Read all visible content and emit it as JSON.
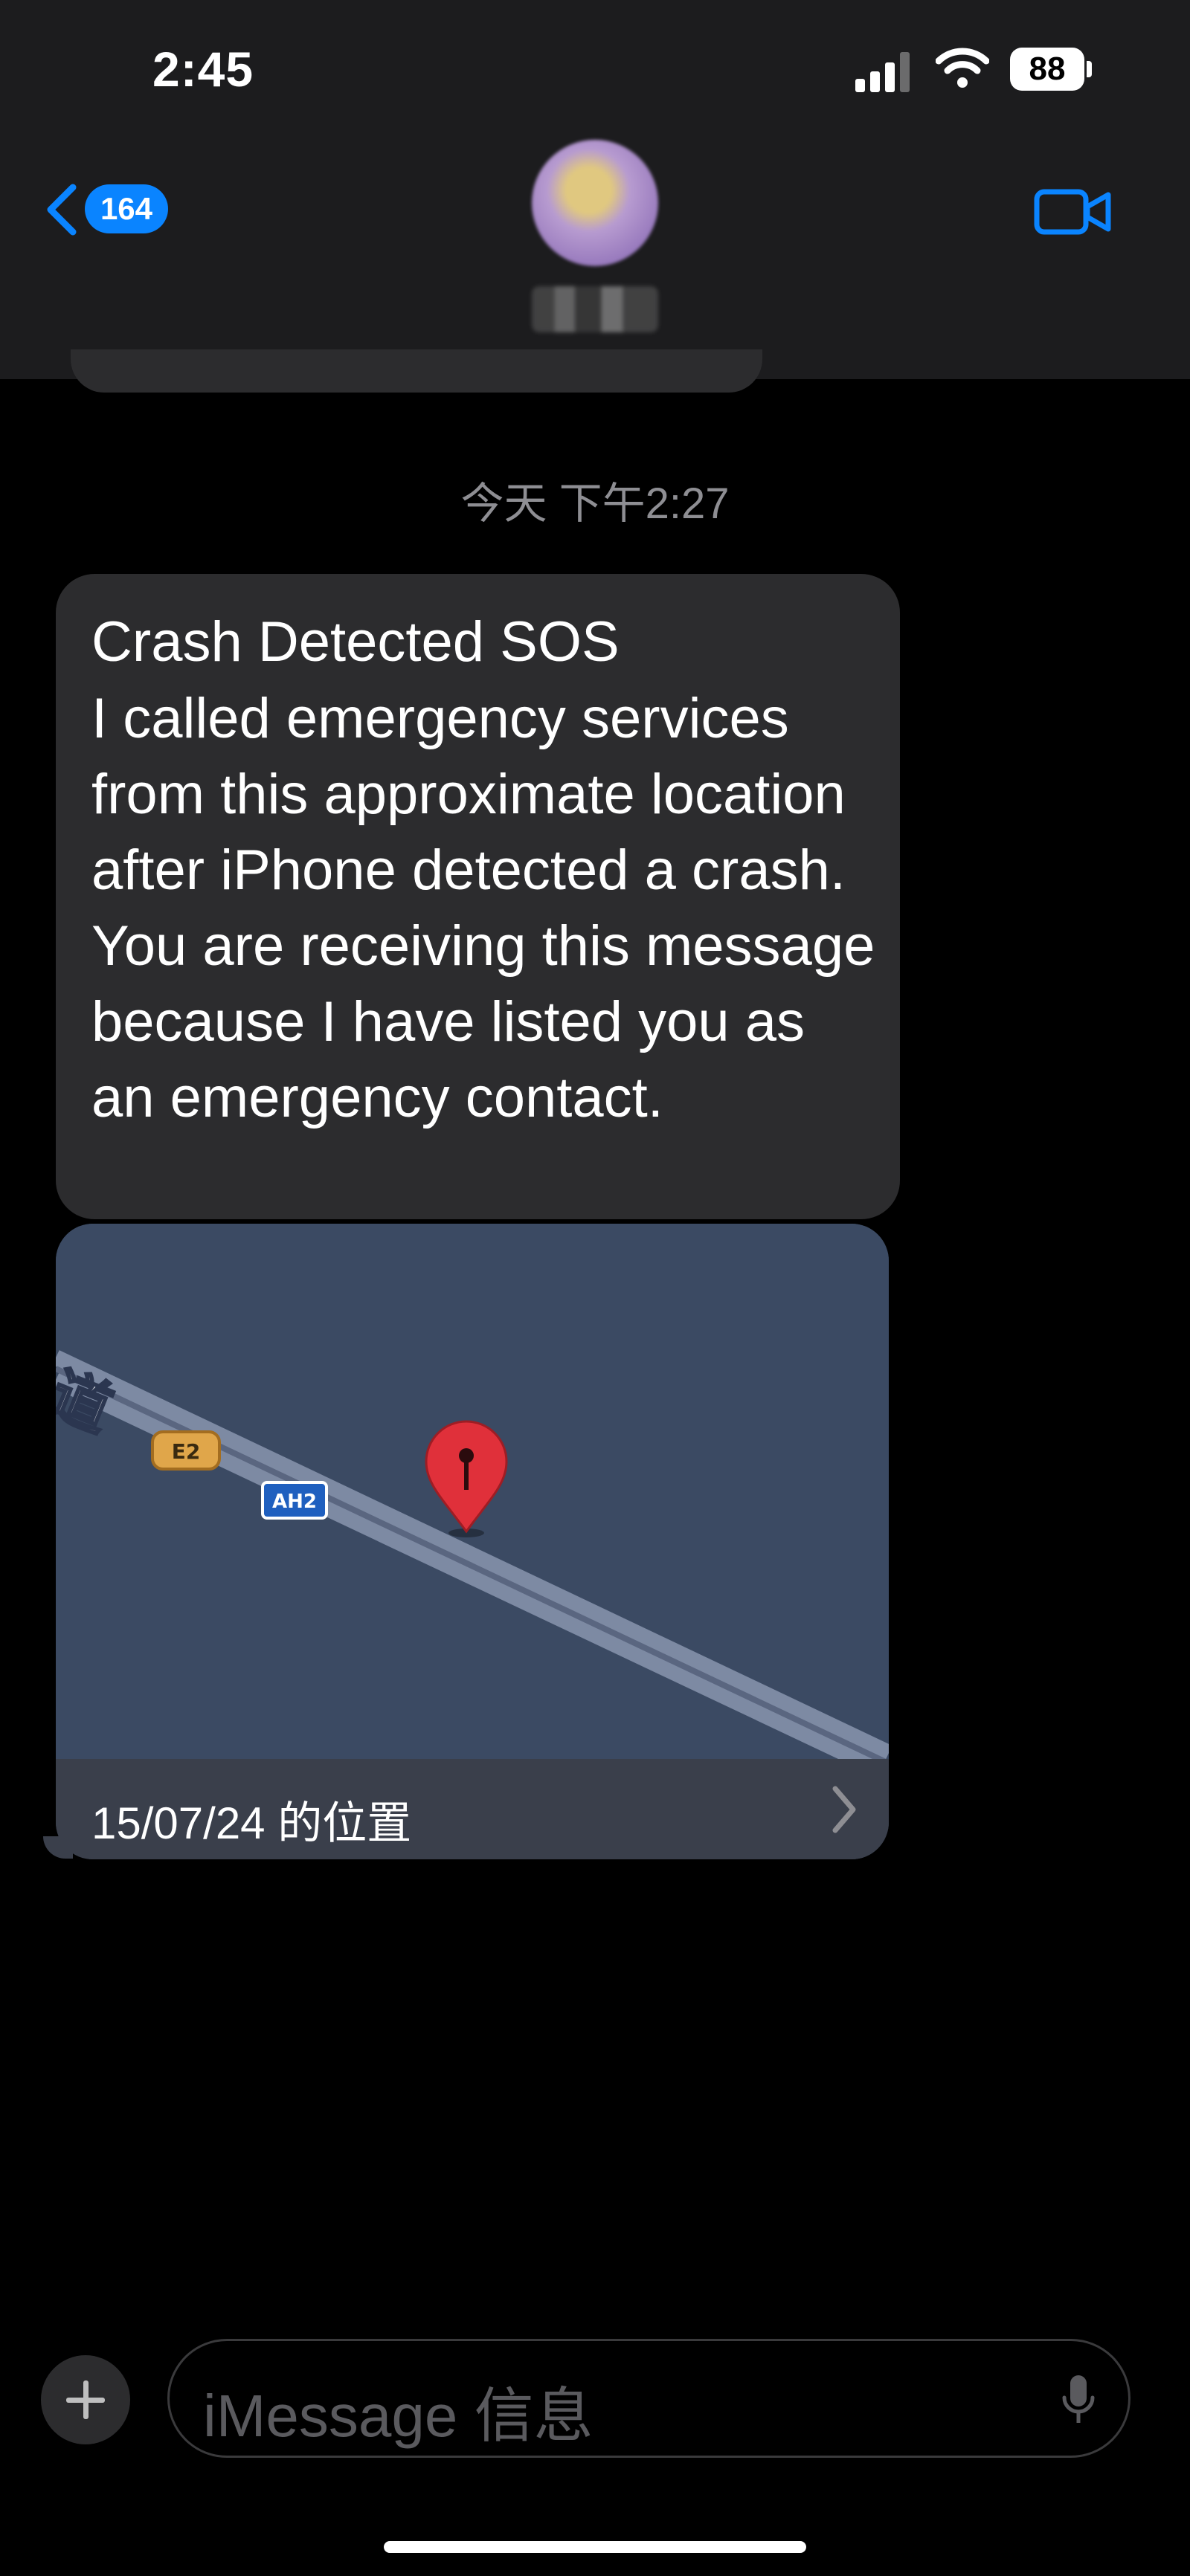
{
  "status_bar": {
    "time": "2:45",
    "battery": "88"
  },
  "header": {
    "back_badge": "164",
    "icons": [
      "back-chevron-icon",
      "video-camera-icon"
    ]
  },
  "conversation": {
    "timestamp": "今天 下午2:27",
    "message": {
      "title": "Crash Detected SOS",
      "body": "I called emergency services from this approximate location after iPhone detected a crash. You are receiving this message because I have listed you as an emergency contact."
    },
    "map": {
      "road_label": "道",
      "route_badges": [
        "E2",
        "AH2"
      ],
      "caption": "15/07/24 的位置"
    }
  },
  "input_bar": {
    "placeholder": "iMessage 信息",
    "icons": [
      "plus-icon",
      "microphone-icon"
    ]
  },
  "colors": {
    "accent": "#0a84ff",
    "bubble": "#2c2c2e",
    "map": "#3b4a63",
    "pin": "#e0303a"
  }
}
